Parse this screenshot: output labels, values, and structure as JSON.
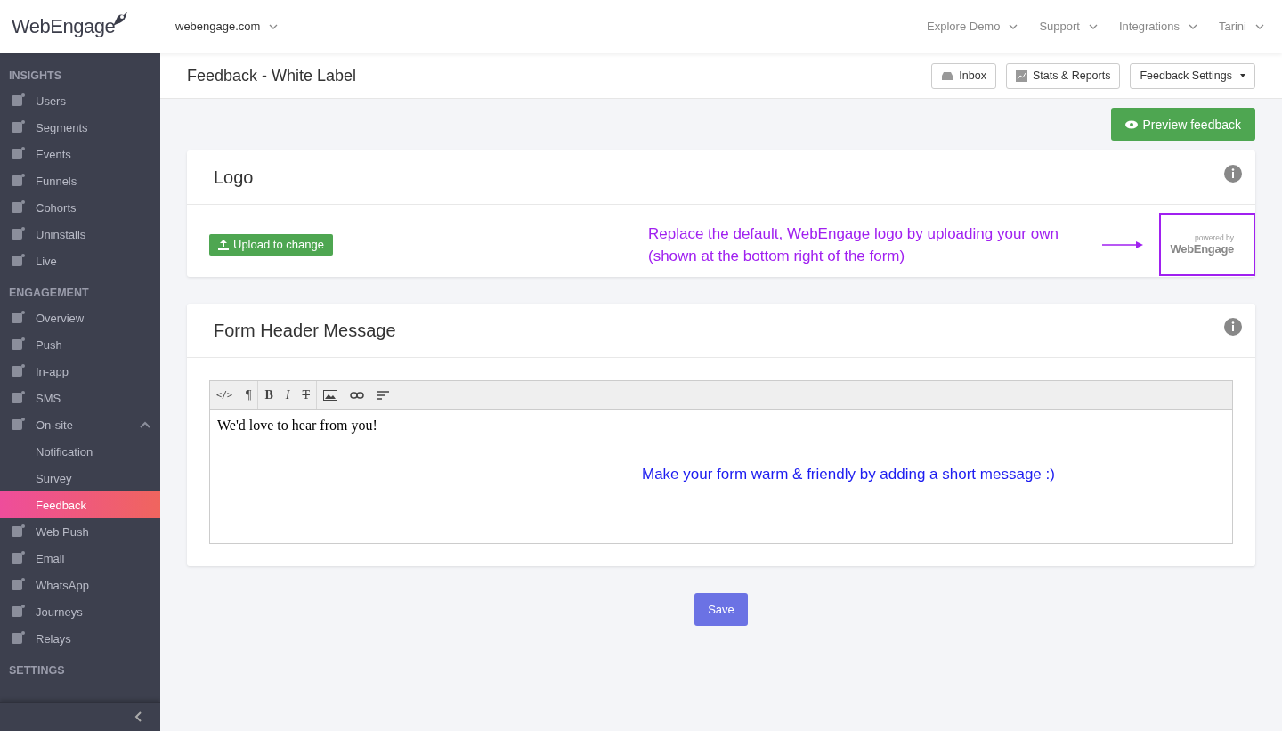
{
  "brand": {
    "logo": "WebEngage"
  },
  "topbar": {
    "account": "webengage.com",
    "menus": [
      "Explore Demo",
      "Support",
      "Integrations",
      "Tarini"
    ]
  },
  "sidebar": {
    "sections": [
      {
        "title": "INSIGHTS",
        "items": [
          {
            "label": "Users",
            "selected": false
          },
          {
            "label": "Segments",
            "selected": false
          },
          {
            "label": "Events",
            "selected": false
          },
          {
            "label": "Funnels",
            "selected": false
          },
          {
            "label": "Cohorts",
            "selected": false
          },
          {
            "label": "Uninstalls",
            "selected": false
          },
          {
            "label": "Live",
            "selected": false
          }
        ]
      },
      {
        "title": "ENGAGEMENT",
        "items": [
          {
            "label": "Overview",
            "selected": false
          },
          {
            "label": "Push",
            "selected": false
          },
          {
            "label": "In-app",
            "selected": false
          },
          {
            "label": "SMS",
            "selected": false
          },
          {
            "label": "On-site",
            "selected": false,
            "expanded": true,
            "children": [
              {
                "label": "Notification",
                "selected": false
              },
              {
                "label": "Survey",
                "selected": false
              },
              {
                "label": "Feedback",
                "selected": true
              }
            ]
          },
          {
            "label": "Web Push",
            "selected": false
          },
          {
            "label": "Email",
            "selected": false
          },
          {
            "label": "WhatsApp",
            "selected": false
          },
          {
            "label": "Journeys",
            "selected": false
          },
          {
            "label": "Relays",
            "selected": false
          }
        ]
      },
      {
        "title": "SETTINGS"
      }
    ]
  },
  "page": {
    "title": "Feedback - White Label",
    "actions": [
      {
        "label": "Inbox",
        "kind": "inbox"
      },
      {
        "label": "Stats & Reports",
        "kind": "stats"
      },
      {
        "label": "Feedback Settings",
        "kind": "dropdown"
      }
    ],
    "preview_button": "Preview feedback"
  },
  "logo_card": {
    "title": "Logo",
    "upload_button": "Upload to change",
    "note": "Replace the default, WebEngage logo by uploading your own (shown at the bottom right of the form)",
    "preview": {
      "caption": "powered by",
      "logo": "WebEngage"
    }
  },
  "header_card": {
    "title": "Form Header Message",
    "toolbar": [
      {
        "kind": "text",
        "label": "</>"
      },
      {
        "kind": "text",
        "label": "¶"
      },
      {
        "kind": "text",
        "label": "B"
      },
      {
        "kind": "text",
        "label": "I"
      },
      {
        "kind": "text",
        "label": "T"
      },
      {
        "kind": "image"
      },
      {
        "kind": "link"
      },
      {
        "kind": "align"
      }
    ],
    "content": "We'd love to hear from you!",
    "note": "Make your form warm & friendly by adding a short message :)"
  },
  "save_button": "Save"
}
